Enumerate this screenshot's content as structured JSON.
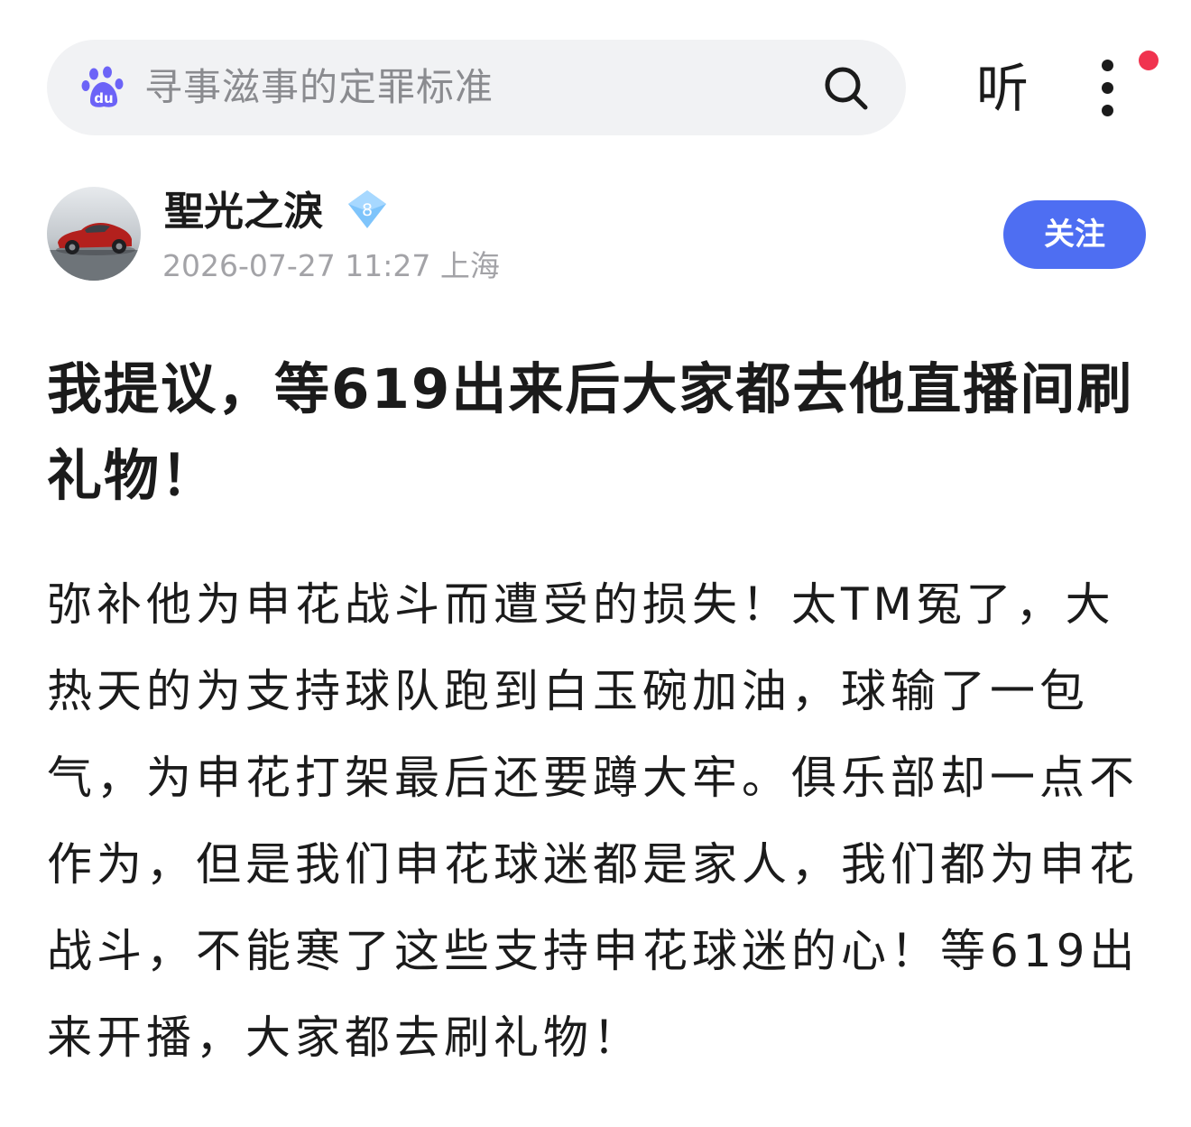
{
  "search": {
    "placeholder": "寻事滋事的定罪标准"
  },
  "header": {
    "listen_label": "听"
  },
  "author": {
    "name": "聖光之淚",
    "level": "8",
    "timestamp": "2026-07-27 11:27",
    "location": "上海"
  },
  "follow": {
    "label": "关注"
  },
  "post": {
    "title": "我提议，等619出来后大家都去他直播间刷礼物！",
    "body": "弥补他为申花战斗而遭受的损失！太TM冤了，大热天的为支持球队跑到白玉碗加油，球输了一包气，为申花打架最后还要蹲大牢。俱乐部却一点不作为，但是我们申花球迷都是家人，我们都为申花战斗，不能寒了这些支持申花球迷的心！等619出来开播，大家都去刷礼物！"
  },
  "colors": {
    "accent": "#4e6ef2",
    "baidu_logo": "#6c63f7",
    "notification": "#f0334f"
  },
  "icons": [
    "baidu-paw-icon",
    "search-icon",
    "more-dots-icon",
    "level-diamond-icon"
  ]
}
